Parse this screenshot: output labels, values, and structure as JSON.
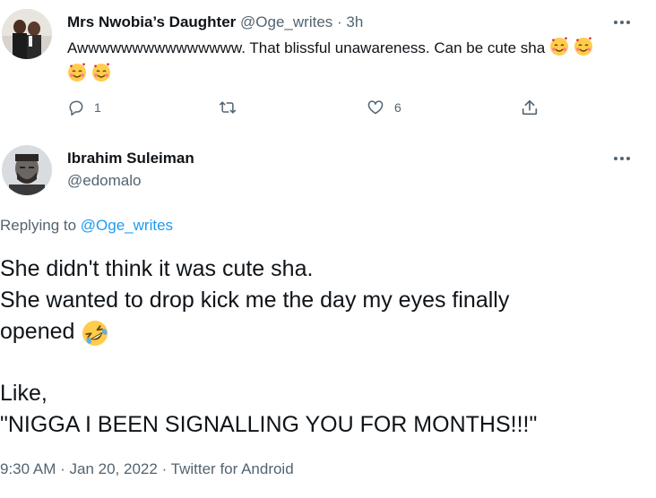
{
  "parent_tweet": {
    "display_name": "Mrs Nwobia’s Daughter",
    "handle": "@Oge_writes",
    "separator": "·",
    "time": "3h",
    "text": "Awwwwwwwwwwwwwww. That blissful unawareness. Can be cute sha",
    "emojis": [
      "smiling-face-with-hearts",
      "smiling-face-with-hearts",
      "smiling-face-with-hearts",
      "smiling-face-with-hearts"
    ],
    "actions": {
      "reply_count": "1",
      "retweet_count": "",
      "like_count": "6"
    }
  },
  "main_tweet": {
    "display_name": "Ibrahim Suleiman",
    "handle": "@edomalo",
    "replying_prefix": "Replying to",
    "replying_to": "@Oge_writes",
    "lines": [
      "She didn't think it was cute sha.",
      "She wanted to drop kick me the day my eyes finally",
      "opened"
    ],
    "inline_emoji": "rolling-on-the-floor-laughing",
    "lines_after_gap": [
      "Like,",
      "\"NIGGA I BEEN SIGNALLING YOU FOR MONTHS!!!\""
    ],
    "meta": {
      "time": "9:30 AM",
      "date": "Jan 20, 2022",
      "source": "Twitter for Android",
      "separator": "·"
    }
  },
  "colors": {
    "text": "#0f1419",
    "secondary": "#536471",
    "link": "#1d9bf0"
  }
}
